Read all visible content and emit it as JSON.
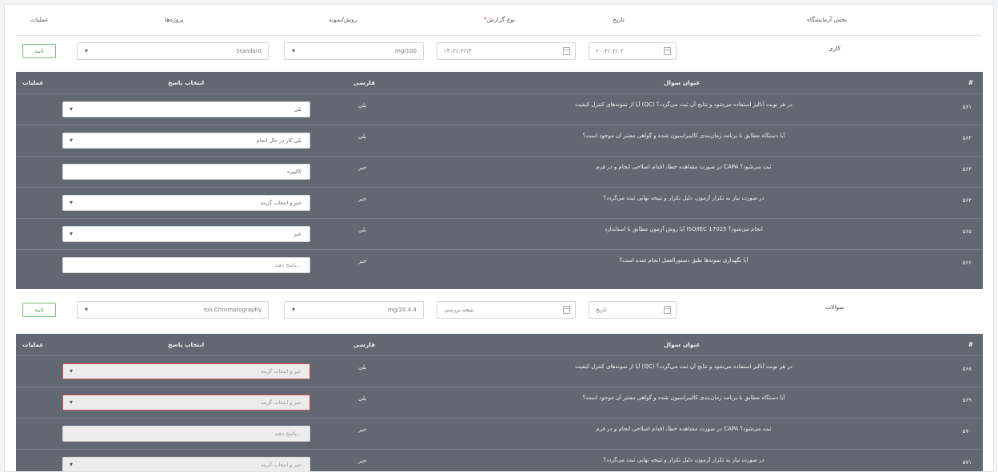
{
  "header": {
    "col_lab_group": "بخش آزمایشگاه",
    "col_date": "تاریخ",
    "col_result_type": "نوع گزارش",
    "col_source": "روش/نمونه",
    "col_worksheet": "پروژه‌ها",
    "col_actions": "عملیات"
  },
  "section1": {
    "label": "کاری",
    "date_value": "۲۰۰۲/۰۲/۰۲",
    "report_value": "۱۴۰۲/۰۲/۱۴",
    "method_value": "mg/100",
    "project_value": "Standard",
    "confirm_label": "تایید"
  },
  "table1": {
    "head_num": "#",
    "head_question": "عنوان سوال",
    "head_lang": "فارسی",
    "head_answer": "انتخاب پاسخ",
    "head_actions": "عملیات",
    "rows": [
      {
        "num": "۵۶۱",
        "question": "آیا از نمونه‌های کنترل کیفیت (QC) در هر نوبت آنالیز استفاده می‌شود و نتایج آن ثبت می‌گردد؟",
        "lang": "بلی",
        "answer": "بلی"
      },
      {
        "num": "۵۶۲",
        "question": "آیا دستگاه مطابق با برنامه زمان‌بندی کالیبراسیون شده و گواهی معتبر آن موجود است؟",
        "lang": "بلی",
        "answer": "بلی کار در حال انجام"
      },
      {
        "num": "۵۶۳",
        "question": "در صورت مشاهده خطا، اقدام اصلاحی انجام و در فرم CAPA ثبت می‌شود؟",
        "lang": "خیر",
        "answer": "کالیبره"
      },
      {
        "num": "۵۶۴",
        "question": "در صورت نیاز به تکرار آزمون، دلیل تکرار و نتیجه نهایی ثبت می‌گردد؟",
        "lang": "خیر",
        "answer": "خیر و انتخاب گزینه"
      },
      {
        "num": "۵۶۵",
        "question": "آیا روش آزمون مطابق با استاندارد ISO/IEC 17025 انجام می‌شود؟",
        "lang": "بلی",
        "answer": "خیر"
      },
      {
        "num": "۵۶۶",
        "question": "آیا نگهداری نمونه‌ها طبق دستورالعمل انجام شده است؟",
        "lang": "خیر",
        "answer": "پاسخ دهید..."
      }
    ]
  },
  "section2": {
    "label": "سوالات",
    "date_value": "تاریخ",
    "report_value": "نتیجه بررسی",
    "method_value": "mg/20.4.4",
    "project_value": "Ion Chromatography",
    "confirm_label": "تایید"
  },
  "table2": {
    "head_num": "#",
    "head_question": "عنوان سوال",
    "head_lang": "فارسی",
    "head_answer": "انتخاب پاسخ",
    "head_actions": "عملیات",
    "rows": [
      {
        "num": "۵۶۸",
        "question": "آیا از نمونه‌های کنترل کیفیت (QC) در هر نوبت آنالیز استفاده می‌شود و نتایج آن ثبت می‌گردد؟",
        "lang": "بلی",
        "answer": "خیر و انتخاب گزینه"
      },
      {
        "num": "۵۶۹",
        "question": "آیا دستگاه مطابق با برنامه زمان‌بندی کالیبراسیون شده و گواهی معتبر آن موجود است؟",
        "lang": "بلی",
        "answer": "خیر و انتخاب گزینه"
      },
      {
        "num": "۵۷۰",
        "question": "در صورت مشاهده خطا، اقدام اصلاحی انجام و در فرم CAPA ثبت می‌شود؟",
        "lang": "خیر",
        "answer": "پاسخ دهید..."
      },
      {
        "num": "۵۷۱",
        "question": "در صورت نیاز به تکرار آزمون، دلیل تکرار و نتیجه نهایی ثبت می‌گردد؟",
        "lang": "خیر",
        "answer": "خیر و انتخاب گزینه"
      }
    ]
  }
}
